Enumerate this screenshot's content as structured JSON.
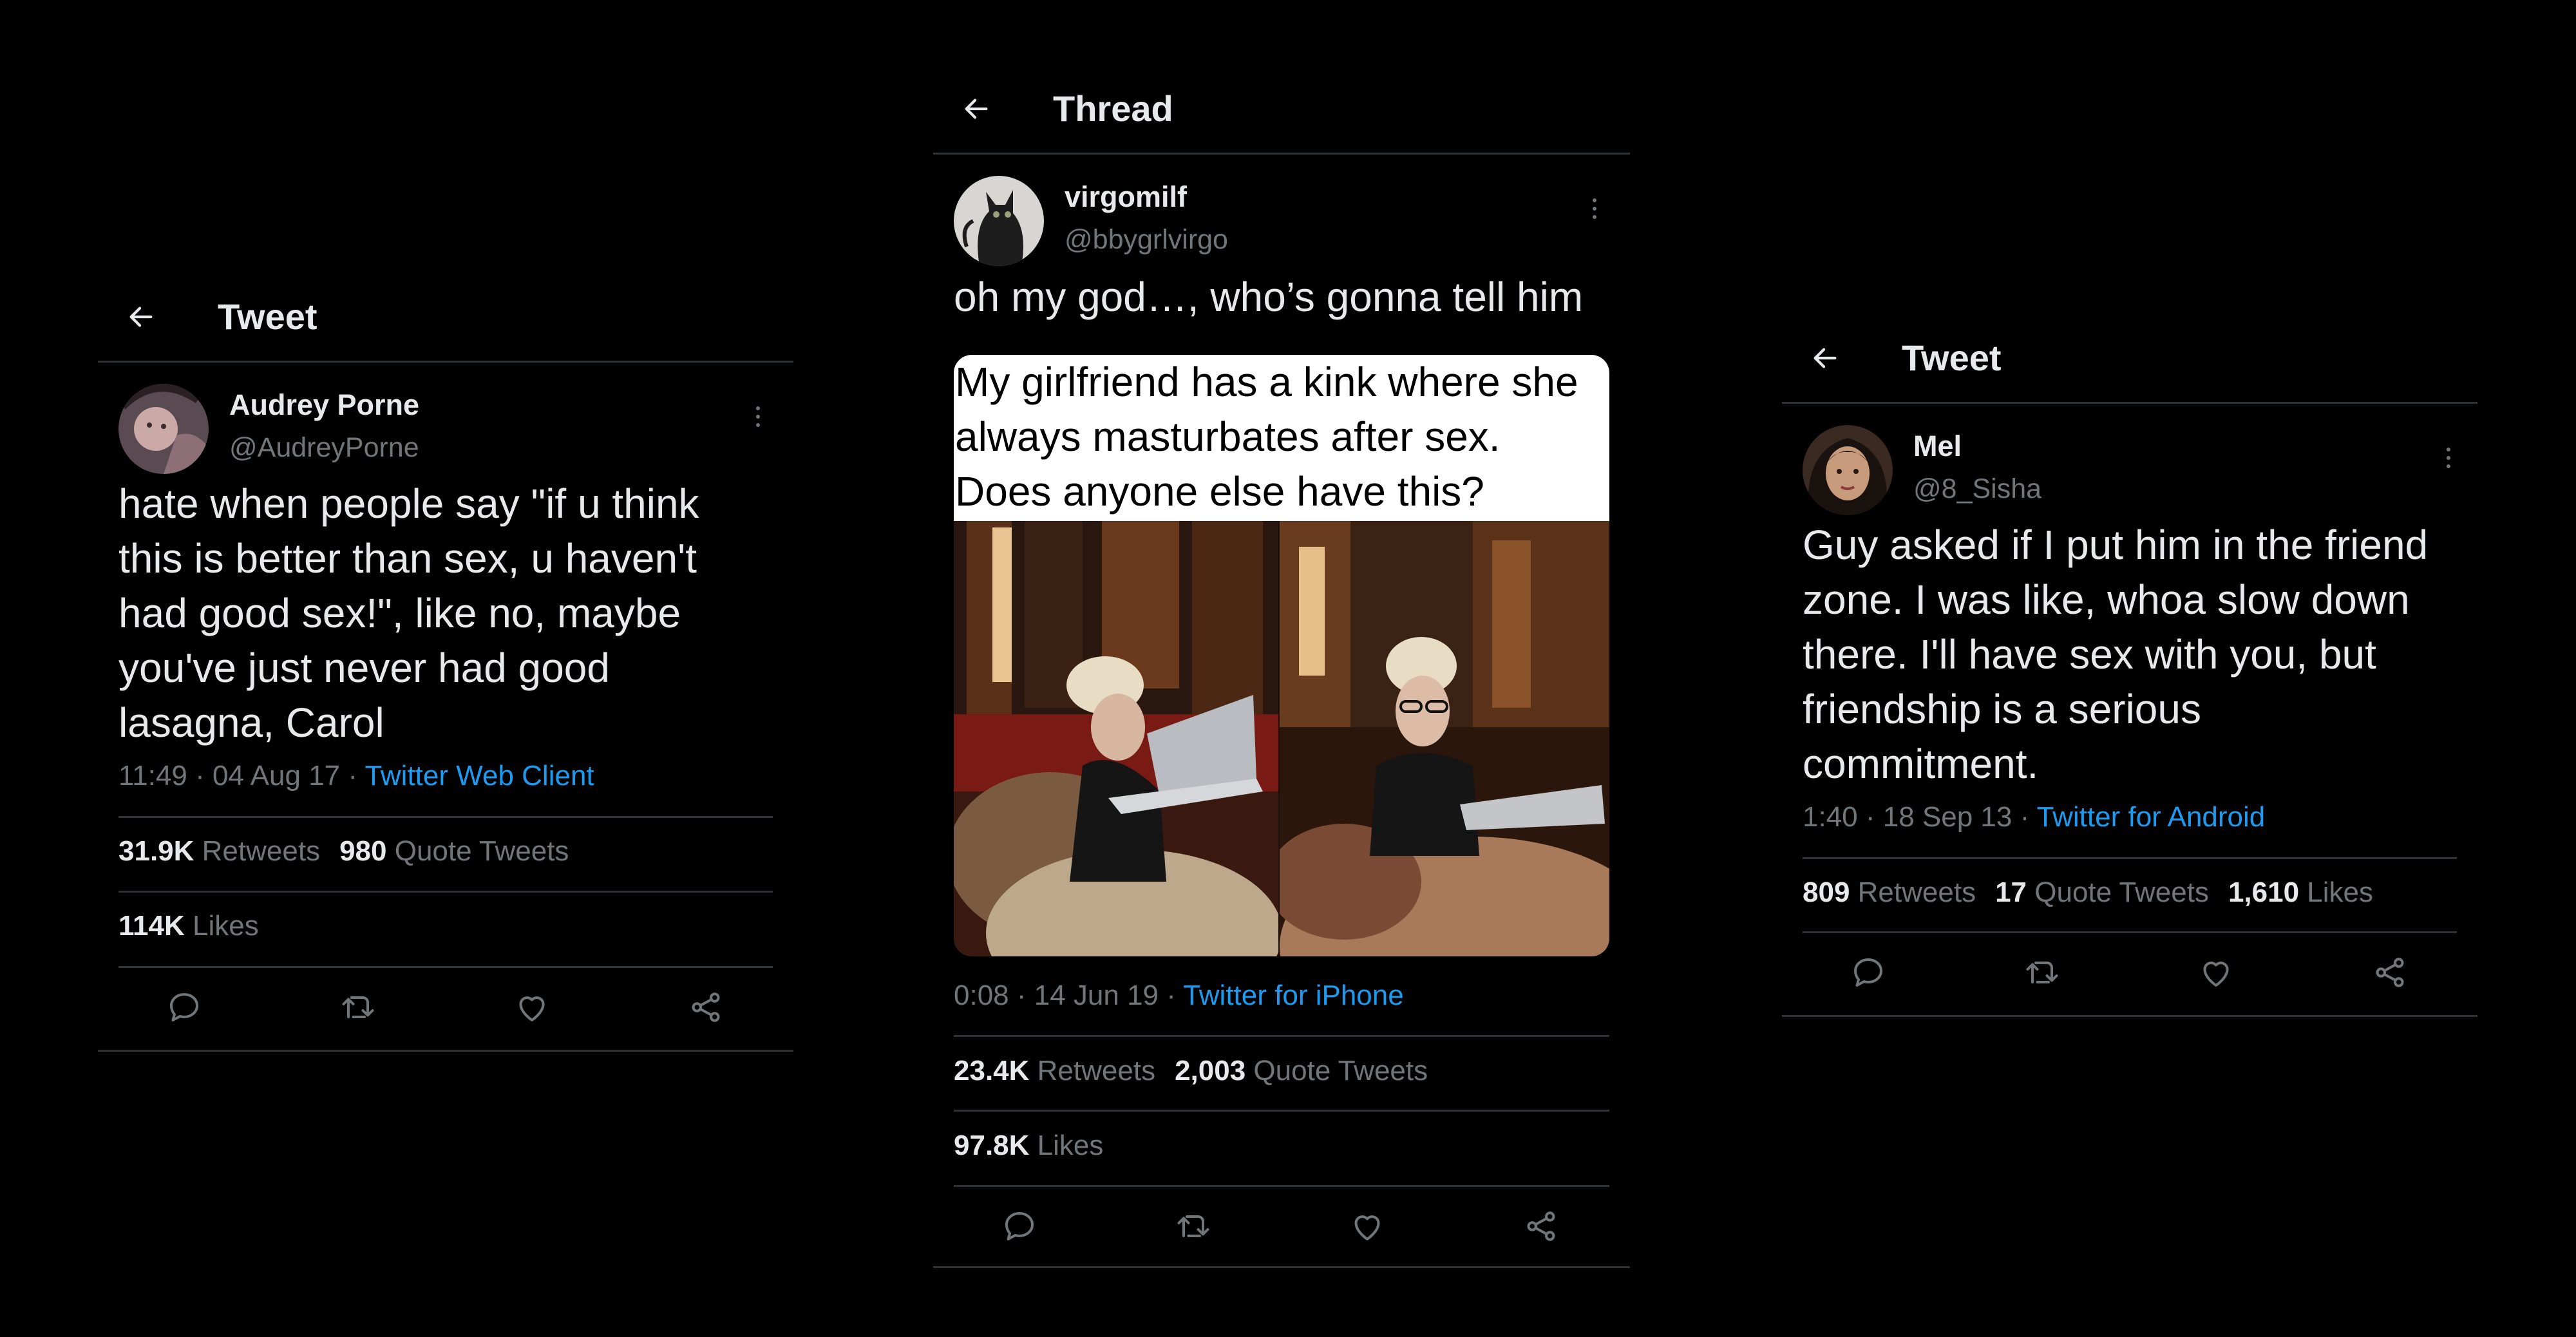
{
  "panels": [
    {
      "header": "Tweet",
      "name": "Audrey Porne",
      "handle": "@AudreyPorne",
      "text": "hate when people say \"if u think\nthis is better than sex, u haven't\nhad good sex!\", like no, maybe\nyou've just never had good\nlasagna, Carol",
      "time": "11:49 · 04 Aug 17 · ",
      "source": "Twitter Web Client",
      "retweets": "31.9K",
      "retweets_label": "Retweets",
      "quotes": "980",
      "quotes_label": "Quote Tweets",
      "likes": "114K",
      "likes_label": "Likes"
    },
    {
      "header": "Thread",
      "name": "virgomilf",
      "handle": "@bbygrlvirgo",
      "text": "oh my god…, who’s gonna tell him",
      "media_caption": "My girlfriend has a kink where she\nalways masturbates after sex.\nDoes anyone else have this?",
      "time": "0:08 · 14 Jun 19 · ",
      "source": "Twitter for iPhone",
      "retweets": "23.4K",
      "retweets_label": "Retweets",
      "quotes": "2,003",
      "quotes_label": "Quote Tweets",
      "likes": "97.8K",
      "likes_label": "Likes"
    },
    {
      "header": "Tweet",
      "name": "Mel",
      "handle": "@8_Sisha",
      "text": "Guy asked if I put him in the friend\nzone. I was like, whoa slow down\nthere. I'll have sex with you, but\nfriendship is a serious\ncommitment.",
      "time": "1:40 · 18 Sep 13 · ",
      "source": "Twitter for Android",
      "retweets": "809",
      "retweets_label": "Retweets",
      "quotes": "17",
      "quotes_label": "Quote Tweets",
      "likes": "1,610",
      "likes_label": "Likes"
    }
  ],
  "icons": {
    "back": "arrow-left-icon",
    "more": "more-vertical-icon",
    "reply": "reply-icon",
    "retweet": "retweet-icon",
    "like": "heart-icon",
    "share": "share-icon"
  },
  "colors": {
    "background": "#000000",
    "text": "#e7e9ea",
    "secondary": "#71767b",
    "link": "#1d9bf0",
    "divider": "#2f3336"
  }
}
